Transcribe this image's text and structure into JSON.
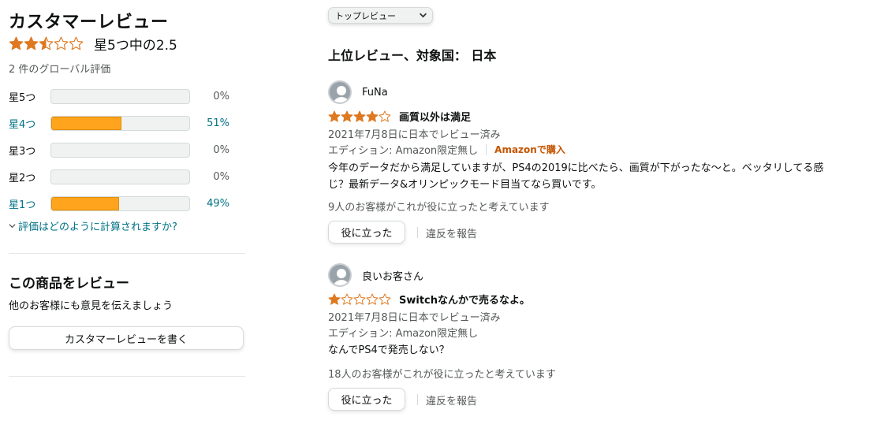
{
  "summary": {
    "title": "カスタマーレビュー",
    "average_stars": 2.5,
    "average_text": "星5つ中の2.5",
    "global_count": "2 件のグローバル評価",
    "histogram": [
      {
        "label": "星5つ",
        "percent": 0,
        "percent_text": "0%",
        "link": false
      },
      {
        "label": "星4つ",
        "percent": 51,
        "percent_text": "51%",
        "link": true
      },
      {
        "label": "星3つ",
        "percent": 0,
        "percent_text": "0%",
        "link": false
      },
      {
        "label": "星2つ",
        "percent": 0,
        "percent_text": "0%",
        "link": false
      },
      {
        "label": "星1つ",
        "percent": 49,
        "percent_text": "49%",
        "link": true
      }
    ],
    "how_calculated": "評価はどのように計算されますか?"
  },
  "write_review": {
    "heading": "この商品をレビュー",
    "subtext": "他のお客様にも意見を伝えましょう",
    "button_label": "カスタマーレビューを書く"
  },
  "sort": {
    "selected": "トップレビュー"
  },
  "reviews_heading": "上位レビュー、対象国： 日本",
  "reviews": [
    {
      "author": "FuNa",
      "stars": 4,
      "title": "画質以外は満足",
      "date": "2021年7月8日に日本でレビュー済み",
      "edition": "エディション: Amazon限定無し",
      "verified": "Amazonで購入",
      "body_line1": "今年のデータだから満足していますが、PS4の2019に比べたら、画質が下がったな〜と。ベッタリしてる感",
      "body_line2": "じ？最新データ&オリンピックモード目当てなら買いです。",
      "helpful_count": "9人のお客様がこれが役に立ったと考えています",
      "helpful_button": "役に立った",
      "report": "違反を報告"
    },
    {
      "author": "良いお客さん",
      "stars": 1,
      "title": "Switchなんかで売るなよ。",
      "date": "2021年7月8日に日本でレビュー済み",
      "edition": "エディション: Amazon限定無し",
      "verified": "",
      "body_line1": "なんでPS4で発売しない？",
      "body_line2": "",
      "helpful_count": "18人のお客様がこれが役に立ったと考えています",
      "helpful_button": "役に立った",
      "report": "違反を報告"
    }
  ],
  "colors": {
    "star": "#de7921",
    "bar_fill": "#ffa41c",
    "link": "#007185",
    "badge": "#c45500"
  }
}
